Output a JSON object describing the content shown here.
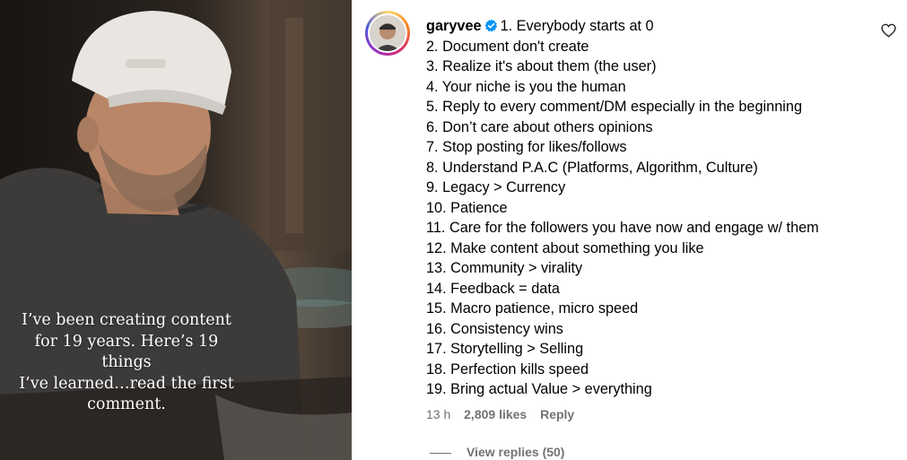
{
  "media": {
    "caption_lines": [
      "I’ve been creating content",
      "for 19 years. Here’s 19 things",
      "I’ve learned…read the first",
      "comment."
    ]
  },
  "comment": {
    "username": "garyvee",
    "verified_icon": "verified-badge-icon",
    "lines": [
      "1. Everybody starts at 0",
      "2. Document don't create",
      "3. Realize it's about them (the user)",
      "4. Your niche is you the human",
      "5. Reply to every comment/DM especially in the beginning",
      "6. Don’t care about others opinions",
      "7. Stop posting for likes/follows",
      "8. Understand P.A.C (Platforms, Algorithm, Culture)",
      "9. Legacy > Currency",
      "10. Patience",
      "11. Care for the followers you have now and engage w/ them",
      "12. Make content about something you like",
      "13. Community > virality",
      "14. Feedback = data",
      "15. Macro patience, micro speed",
      "16. Consistency wins",
      "17. Storytelling > Selling",
      "18. Perfection kills speed",
      "19. Bring actual Value > everything"
    ],
    "time": "13 h",
    "likes": "2,809 likes",
    "reply_label": "Reply",
    "view_replies": "View replies (50)",
    "like_icon": "heart-icon"
  },
  "colors": {
    "verified": "#0095f6",
    "meta_text": "#737373",
    "story_ring": [
      "#feda75",
      "#fa7e1e",
      "#d62976",
      "#962fbf",
      "#4f5bd5"
    ]
  }
}
